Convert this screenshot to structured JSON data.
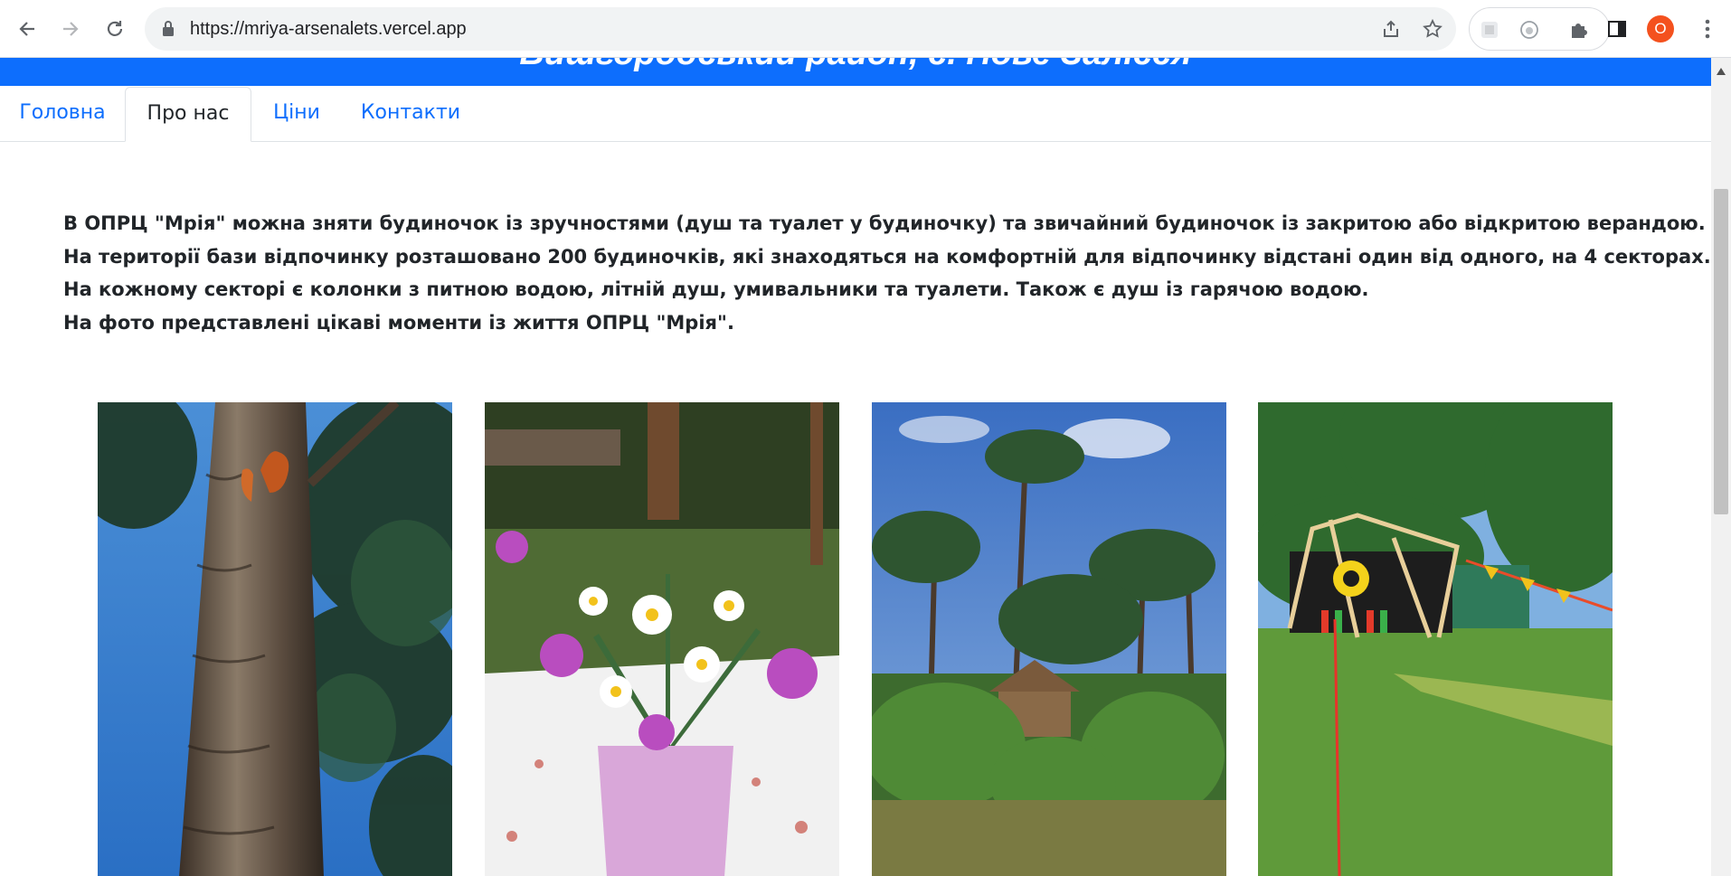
{
  "browser": {
    "url": "https://mriya-arsenalets.vercel.app",
    "profile_initial": "O",
    "icons": {
      "back": "back-arrow-icon",
      "forward": "forward-arrow-icon",
      "reload": "reload-icon",
      "lock": "lock-icon",
      "share": "share-icon",
      "bookmark": "star-icon",
      "extensions": "puzzle-icon",
      "side_panel": "side-panel-icon",
      "menu": "kebab-menu-icon"
    }
  },
  "site": {
    "banner_title": "Вишгородський район, с. Нове Залісся",
    "banner_color": "#0d6efd",
    "tabs": [
      {
        "label": "Головна",
        "active": false
      },
      {
        "label": "Про нас",
        "active": true
      },
      {
        "label": "Ціни",
        "active": false
      },
      {
        "label": "Контакти",
        "active": false
      }
    ],
    "about_paragraphs": [
      "В ОПРЦ \"Мрія\" можна зняти будиночок із зручностями (душ та туалет у будиночку) та звичайний будиночок із закритою або відкритою верандою.",
      "На території бази відпочинку розташовано 200 будиночків, які знаходяться на комфортній для відпочинку відстані один від одного, на 4 секторах.",
      "На кожному секторі є колонки з питною водою, літній душ, умивальники та туалети. Також є душ із гарячою водою.",
      "На фото представлені цікаві моменти із життя ОПРЦ \"Мрія\"."
    ],
    "gallery": [
      {
        "subject": "squirrel-on-pine-tree-photo"
      },
      {
        "subject": "wildflower-bouquet-photo"
      },
      {
        "subject": "pine-forest-cabin-photo"
      },
      {
        "subject": "painted-stage-on-lawn-photo"
      }
    ]
  }
}
